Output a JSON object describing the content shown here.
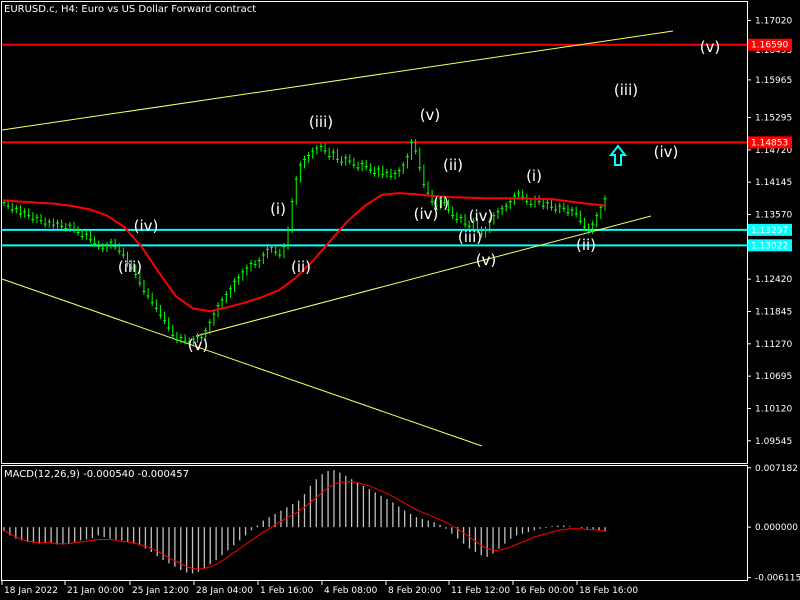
{
  "chart_data": [
    {
      "type": "candlestick",
      "title": "EURUSD.c, H4:  Euro vs US Dollar Forward contract",
      "ylim": [
        1.0915,
        1.1735
      ],
      "y_ticks": [
        "1.17020",
        "1.16495",
        "1.15965",
        "1.15295",
        "1.14720",
        "1.14145",
        "1.13570",
        "1.12995",
        "1.12420",
        "1.11845",
        "1.11270",
        "1.10695",
        "1.10120",
        "1.09545"
      ],
      "x_ticks": [
        "18 Jan 2022",
        "21 Jan 00:00",
        "25 Jan 12:00",
        "28 Jan 04:00",
        "1 Feb 16:00",
        "4 Feb 08:00",
        "8 Feb 20:00",
        "11 Feb 12:00",
        "16 Feb 00:00",
        "18 Feb 16:00"
      ],
      "close": [
        1.1378,
        1.1372,
        1.1365,
        1.1368,
        1.1358,
        1.1362,
        1.1355,
        1.1348,
        1.1352,
        1.1346,
        1.134,
        1.1344,
        1.1338,
        1.1342,
        1.1336,
        1.1332,
        1.1338,
        1.133,
        1.1325,
        1.1318,
        1.1322,
        1.1312,
        1.1305,
        1.13,
        1.1296,
        1.1302,
        1.1308,
        1.13,
        1.1292,
        1.1285,
        1.127,
        1.1262,
        1.125,
        1.1235,
        1.122,
        1.1212,
        1.12,
        1.119,
        1.1178,
        1.1168,
        1.1155,
        1.1142,
        1.1134,
        1.1138,
        1.1132,
        1.113,
        1.1135,
        1.114,
        1.1138,
        1.115,
        1.1165,
        1.118,
        1.1195,
        1.1205,
        1.1215,
        1.1225,
        1.1238,
        1.1245,
        1.1255,
        1.1262,
        1.127,
        1.1268,
        1.1275,
        1.1285,
        1.1295,
        1.1298,
        1.129,
        1.1285,
        1.13,
        1.133,
        1.138,
        1.142,
        1.1445,
        1.1455,
        1.1462,
        1.147,
        1.1475,
        1.1478,
        1.147,
        1.146,
        1.1468,
        1.1455,
        1.145,
        1.1458,
        1.1452,
        1.1445,
        1.144,
        1.1448,
        1.1442,
        1.1436,
        1.143,
        1.1438,
        1.1428,
        1.1432,
        1.1425,
        1.143,
        1.1435,
        1.1445,
        1.146,
        1.1485,
        1.147,
        1.144,
        1.141,
        1.1395,
        1.138,
        1.1372,
        1.1385,
        1.1378,
        1.1365,
        1.1355,
        1.1348,
        1.1352,
        1.134,
        1.1336,
        1.1345,
        1.133,
        1.1322,
        1.133,
        1.1345,
        1.1355,
        1.1362,
        1.1368,
        1.1372,
        1.138,
        1.139,
        1.1395,
        1.1388,
        1.138,
        1.1375,
        1.1385,
        1.138,
        1.1372,
        1.1378,
        1.137,
        1.1365,
        1.1372,
        1.1368,
        1.136,
        1.1365,
        1.1358,
        1.1345,
        1.1335,
        1.1328,
        1.134,
        1.1355,
        1.137,
        1.1385
      ],
      "moving_average": [
        1.1382,
        1.138,
        1.1378,
        1.1376,
        1.1372,
        1.1366,
        1.1355,
        1.1335,
        1.13,
        1.1255,
        1.1212,
        1.119,
        1.1185,
        1.1192,
        1.12,
        1.121,
        1.1222,
        1.1245,
        1.1275,
        1.131,
        1.1345,
        1.1372,
        1.1392,
        1.1395,
        1.1393,
        1.139,
        1.1388,
        1.1387,
        1.1386,
        1.1386,
        1.1386,
        1.1385,
        1.1384,
        1.138,
        1.1376,
        1.1373
      ],
      "horizontal_levels": [
        {
          "value": 1.1659,
          "label": "1.16590",
          "color": "#ff0000"
        },
        {
          "value": 1.14853,
          "label": "1.14853",
          "color": "#ff0000"
        },
        {
          "value": 1.13297,
          "label": "1.13297",
          "color": "#00ffff"
        },
        {
          "value": 1.13022,
          "label": "1.13022",
          "color": "#00ffff"
        }
      ],
      "wave_labels": [
        "(iv)",
        "(iii)",
        "(v)",
        "(i)",
        "(ii)",
        "(iii)",
        "(v)",
        "(ii)",
        "(i)",
        "(iv)",
        "(iv)",
        "(iii)",
        "(v)",
        "(i)",
        "(ii)",
        "(v)",
        "(iii)",
        "(iv)"
      ],
      "projection_arrow": "up",
      "colors": {
        "candle": "#00ff00",
        "ma": "#ff0000",
        "trendline": "#ffff66",
        "cyan": "#00ffff",
        "red": "#ff0000"
      }
    },
    {
      "type": "histogram",
      "title": "MACD(12,26,9) -0.000540 -0.000457",
      "y_ticks": [
        "0.007182",
        "0.000000",
        "-0.006115"
      ],
      "ylim": [
        -0.0064,
        0.0074
      ],
      "histogram": [
        -0.0005,
        -0.001,
        -0.0014,
        -0.0016,
        -0.0018,
        -0.0019,
        -0.002,
        -0.0019,
        -0.002,
        -0.0021,
        -0.0021,
        -0.002,
        -0.0018,
        -0.0016,
        -0.0015,
        -0.0013,
        -0.001,
        -0.0012,
        -0.0014,
        -0.0015,
        -0.0016,
        -0.0018,
        -0.002,
        -0.0022,
        -0.0026,
        -0.003,
        -0.0035,
        -0.004,
        -0.0044,
        -0.0048,
        -0.0052,
        -0.0055,
        -0.0056,
        -0.0054,
        -0.005,
        -0.0045,
        -0.004,
        -0.0034,
        -0.0028,
        -0.0022,
        -0.0016,
        -0.001,
        -0.0004,
        0.0002,
        0.0008,
        0.0012,
        0.0016,
        0.002,
        0.0024,
        0.0028,
        0.0032,
        0.004,
        0.005,
        0.0058,
        0.0064,
        0.0068,
        0.0069,
        0.0066,
        0.0062,
        0.0058,
        0.0054,
        0.005,
        0.0046,
        0.0042,
        0.0038,
        0.0034,
        0.003,
        0.0025,
        0.002,
        0.0016,
        0.0012,
        0.001,
        0.0008,
        0.0006,
        0.0003,
        -0.0002,
        -0.0008,
        -0.0014,
        -0.002,
        -0.0026,
        -0.003,
        -0.0034,
        -0.0036,
        -0.0032,
        -0.0026,
        -0.002,
        -0.0014,
        -0.001,
        -0.0008,
        -0.0006,
        -0.0004,
        -0.0002,
        -0.0001,
        0.0001,
        0.0002,
        0.0002,
        0.0001,
        0.0,
        -0.0001,
        -0.0002,
        -0.0003,
        -0.0004,
        -0.0005
      ],
      "signal": [
        -0.0004,
        -0.0008,
        -0.0012,
        -0.0015,
        -0.0017,
        -0.0018,
        -0.0019,
        -0.0019,
        -0.0019,
        -0.002,
        -0.002,
        -0.002,
        -0.0019,
        -0.0018,
        -0.0017,
        -0.0016,
        -0.0015,
        -0.0015,
        -0.0015,
        -0.0016,
        -0.0017,
        -0.0018,
        -0.0019,
        -0.0021,
        -0.0023,
        -0.0026,
        -0.0029,
        -0.0033,
        -0.0037,
        -0.0041,
        -0.0044,
        -0.0048,
        -0.005,
        -0.0051,
        -0.005,
        -0.0048,
        -0.0045,
        -0.0041,
        -0.0036,
        -0.0031,
        -0.0026,
        -0.0021,
        -0.0016,
        -0.0011,
        -0.0006,
        -0.0002,
        0.0003,
        0.0007,
        0.0011,
        0.0015,
        0.0019,
        0.0024,
        0.003,
        0.0036,
        0.0042,
        0.0048,
        0.0052,
        0.0054,
        0.0055,
        0.0055,
        0.0054,
        0.0052,
        0.005,
        0.0047,
        0.0044,
        0.0041,
        0.0037,
        0.0033,
        0.0029,
        0.0025,
        0.0021,
        0.0018,
        0.0015,
        0.0012,
        0.0009,
        0.0006,
        0.0002,
        -0.0002,
        -0.0007,
        -0.0012,
        -0.0017,
        -0.0022,
        -0.0026,
        -0.0028,
        -0.0028,
        -0.0026,
        -0.0024,
        -0.0021,
        -0.0018,
        -0.0015,
        -0.0012,
        -0.001,
        -0.0008,
        -0.0006,
        -0.0004,
        -0.0003,
        -0.0002,
        -0.0002,
        -0.0002,
        -0.0003,
        -0.0003,
        -0.0004,
        -0.0005
      ],
      "colors": {
        "histogram": "#c0c0c0",
        "signal": "#ff0000"
      }
    }
  ]
}
